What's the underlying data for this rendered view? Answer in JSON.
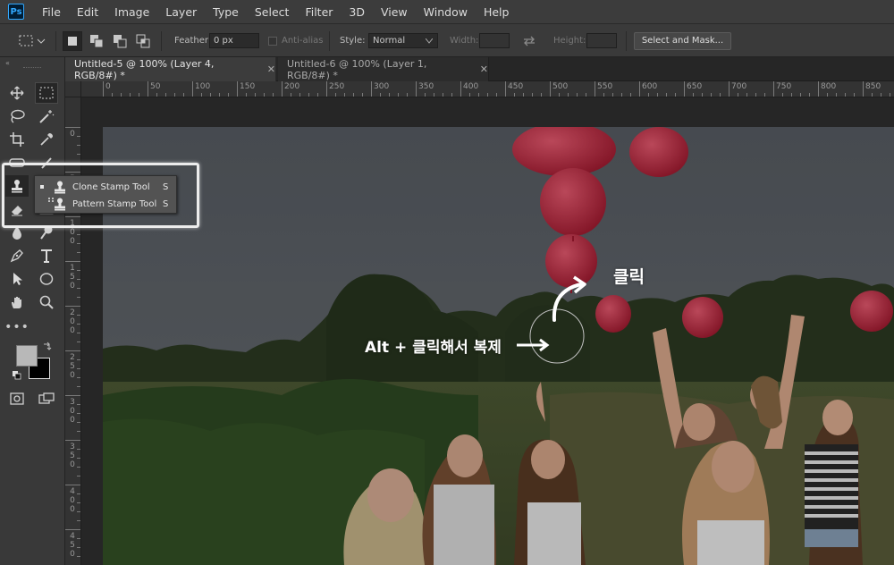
{
  "app": {
    "logo": "Ps"
  },
  "menu": [
    "File",
    "Edit",
    "Image",
    "Layer",
    "Type",
    "Select",
    "Filter",
    "3D",
    "View",
    "Window",
    "Help"
  ],
  "options": {
    "feather_label": "Feather:",
    "feather_value": "0 px",
    "antialias_label": "Anti-alias",
    "style_label": "Style:",
    "style_value": "Normal",
    "width_label": "Width:",
    "height_label": "Height:",
    "mask_button": "Select and Mask..."
  },
  "tabs": [
    {
      "label": "Untitled-5 @ 100% (Layer 4, RGB/8#) *",
      "close": "✕",
      "active": true
    },
    {
      "label": "Untitled-6 @ 100% (Layer 1, RGB/8#) *",
      "close": "✕",
      "active": false
    }
  ],
  "ruler_top": [
    "0",
    "50",
    "100",
    "150",
    "200",
    "250",
    "300",
    "350",
    "400",
    "450",
    "500",
    "550",
    "600",
    "650",
    "700",
    "750",
    "800",
    "850"
  ],
  "ruler_left": [
    "0",
    "5\n0",
    "1\n0\n0",
    "1\n5\n0",
    "2\n0\n0",
    "2\n5\n0",
    "3\n0\n0",
    "3\n5\n0",
    "4\n0\n0",
    "4\n5\n0"
  ],
  "flyout": {
    "items": [
      {
        "label": "Clone Stamp Tool",
        "key": "S",
        "selected": true
      },
      {
        "label": "Pattern Stamp Tool",
        "key": "S",
        "selected": false
      }
    ]
  },
  "annotations": {
    "click": "클릭",
    "alt_click": "Alt + 클릭해서 복제"
  },
  "colors": {
    "foreground": "#b8b8b8",
    "background": "#000000",
    "accent": "#31a8ff"
  }
}
